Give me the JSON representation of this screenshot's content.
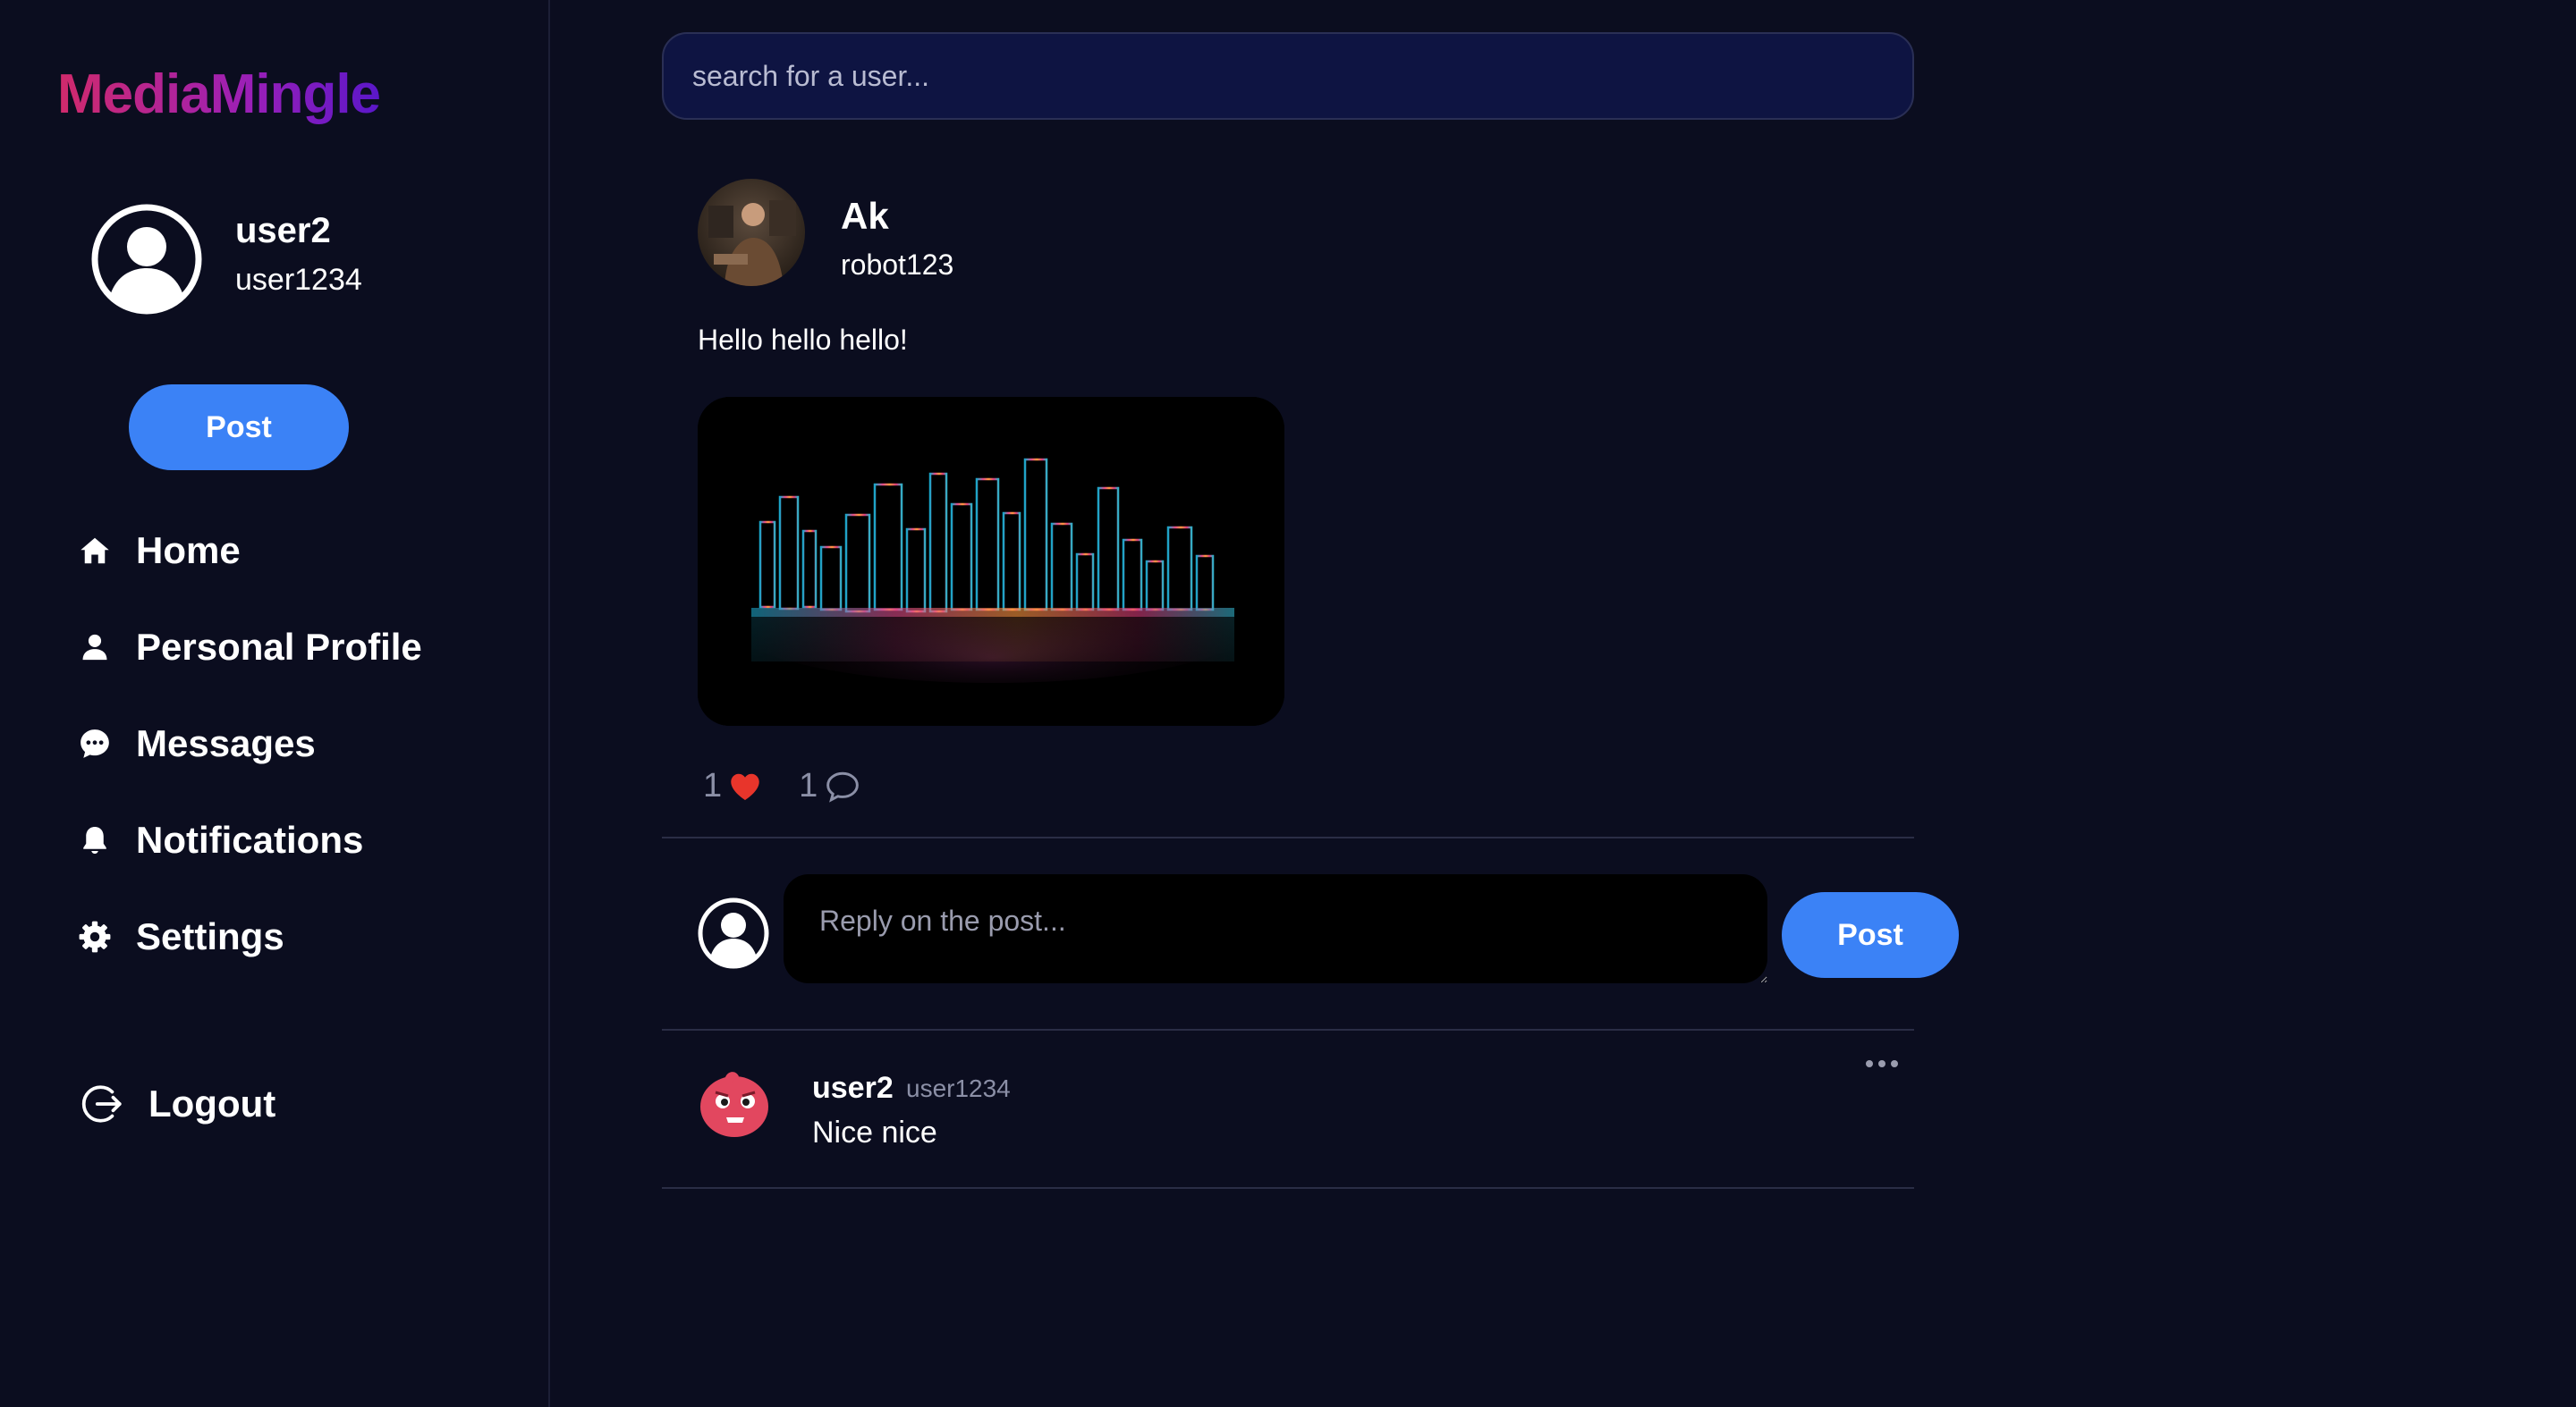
{
  "app": {
    "logo": "MediaMingle"
  },
  "current_user": {
    "name": "user2",
    "handle": "user1234"
  },
  "sidebar": {
    "post_label": "Post",
    "items": [
      {
        "label": "Home",
        "icon": "home-icon"
      },
      {
        "label": "Personal Profile",
        "icon": "person-icon"
      },
      {
        "label": "Messages",
        "icon": "chat-bubble-icon"
      },
      {
        "label": "Notifications",
        "icon": "bell-icon"
      },
      {
        "label": "Settings",
        "icon": "gear-icon"
      }
    ],
    "logout_label": "Logout"
  },
  "search": {
    "placeholder": "search for a user..."
  },
  "post": {
    "author_name": "Ak",
    "author_handle": "robot123",
    "text": "Hello hello hello!",
    "likes": "1",
    "comments": "1"
  },
  "reply": {
    "placeholder": "Reply on the post...",
    "button_label": "Post"
  },
  "comments": [
    {
      "name": "user2",
      "handle": "user1234",
      "text": "Nice nice"
    }
  ],
  "colors": {
    "background": "#0b0d1f",
    "accent": "#3b82f6",
    "like": "#e8352b",
    "logo_start": "#d12a6b",
    "logo_end": "#5a17c9"
  }
}
